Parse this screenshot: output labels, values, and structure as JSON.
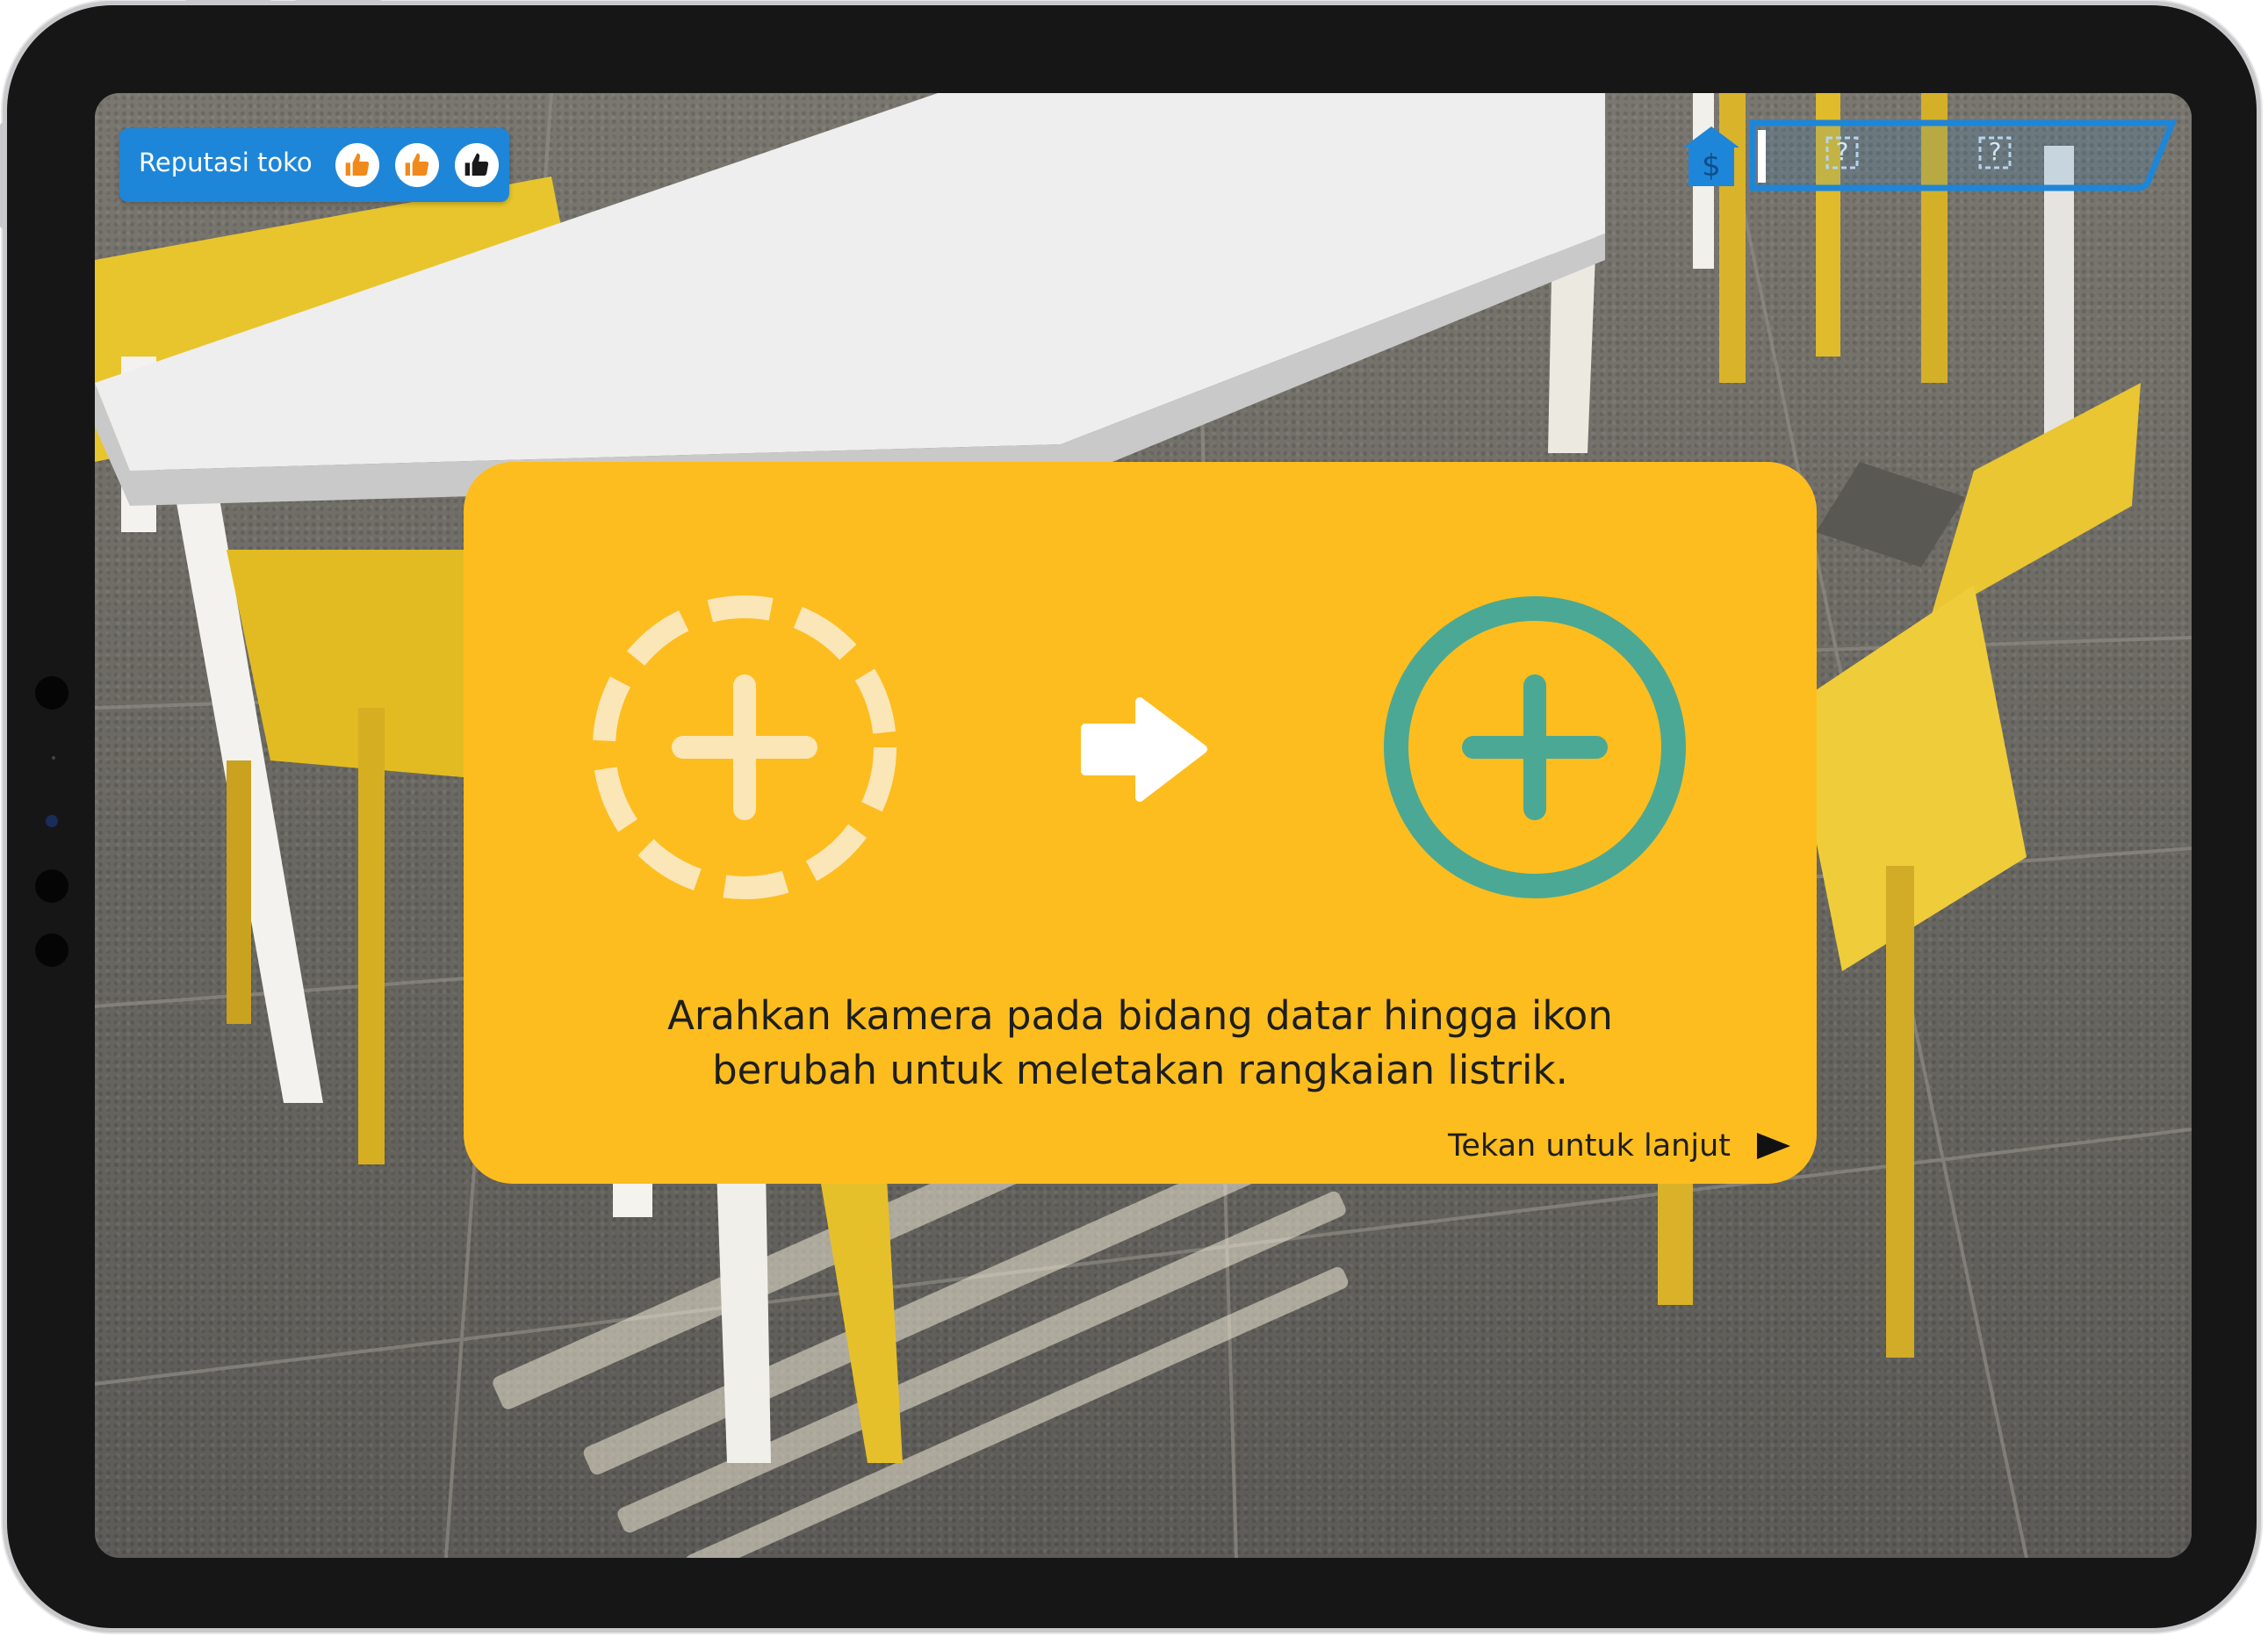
{
  "hud": {
    "reputation_label": "Reputasi toko",
    "reputation_icons": [
      "thumbs-up-icon",
      "thumbs-up-icon",
      "thumbs-up-icon"
    ],
    "reputation_state": [
      "earned",
      "earned",
      "empty"
    ],
    "slots": [
      "?",
      "?"
    ]
  },
  "tutorial": {
    "instruction": "Arahkan kamera pada bidang datar hingga ikon berubah untuk meletakan rangkaian listrik.",
    "continue_label": "Tekan untuk lanjut"
  },
  "colors": {
    "card": "#FDBD1F",
    "hud_blue": "#1E86D8",
    "placed_icon": "#4BA895",
    "pending_icon": "#FBE6B8",
    "thumb_earned": "#F08A1C",
    "thumb_empty": "#1A1A1A"
  }
}
